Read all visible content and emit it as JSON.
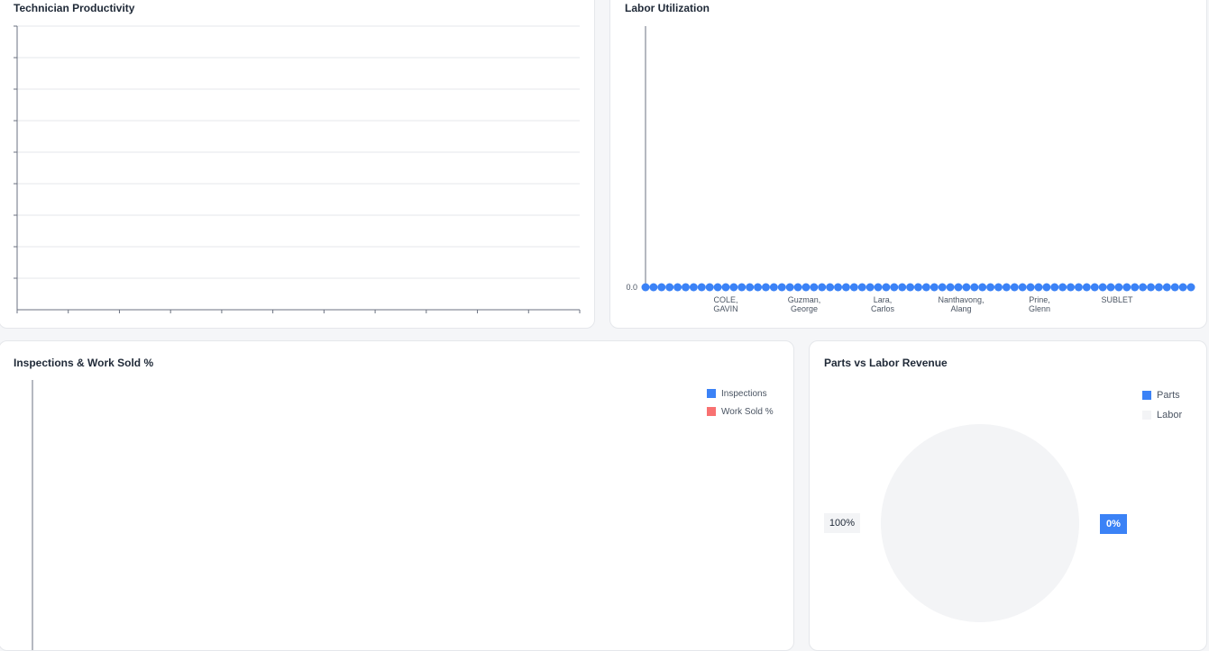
{
  "technician_productivity": {
    "title": "Technician Productivity"
  },
  "labor_utilization": {
    "title": "Labor Utilization",
    "chart_data": {
      "type": "line",
      "title": "Labor Utilization",
      "xlabel": "",
      "ylabel": "",
      "y_tick_labels": [
        "0.0"
      ],
      "x_tick_labels": [
        "COLE,\nGAVIN",
        "Guzman,\nGeorge",
        "Lara,\nCarlos",
        "Nanthavong,\nAlang",
        "Prine,\nGlenn",
        "SUBLET"
      ],
      "series": [
        {
          "values_all": 0,
          "point_count": 69,
          "color": "#3b82f6"
        }
      ],
      "grid": false
    }
  },
  "inspections_work_sold": {
    "title": "Inspections & Work Sold %",
    "legend": [
      {
        "label": "Inspections",
        "color": "#3b82f6"
      },
      {
        "label": "Work Sold %",
        "color": "#f87171"
      }
    ]
  },
  "parts_vs_labor": {
    "title": "Parts vs Labor Revenue",
    "legend": [
      {
        "label": "Parts",
        "color": "#3b82f6"
      },
      {
        "label": "Labor",
        "color": "#f3f4f6"
      }
    ],
    "chart_data": {
      "type": "pie",
      "title": "Parts vs Labor Revenue",
      "categories": [
        "Parts",
        "Labor"
      ],
      "values": [
        0,
        100
      ],
      "labels": [
        "0%",
        "100%"
      ]
    }
  }
}
